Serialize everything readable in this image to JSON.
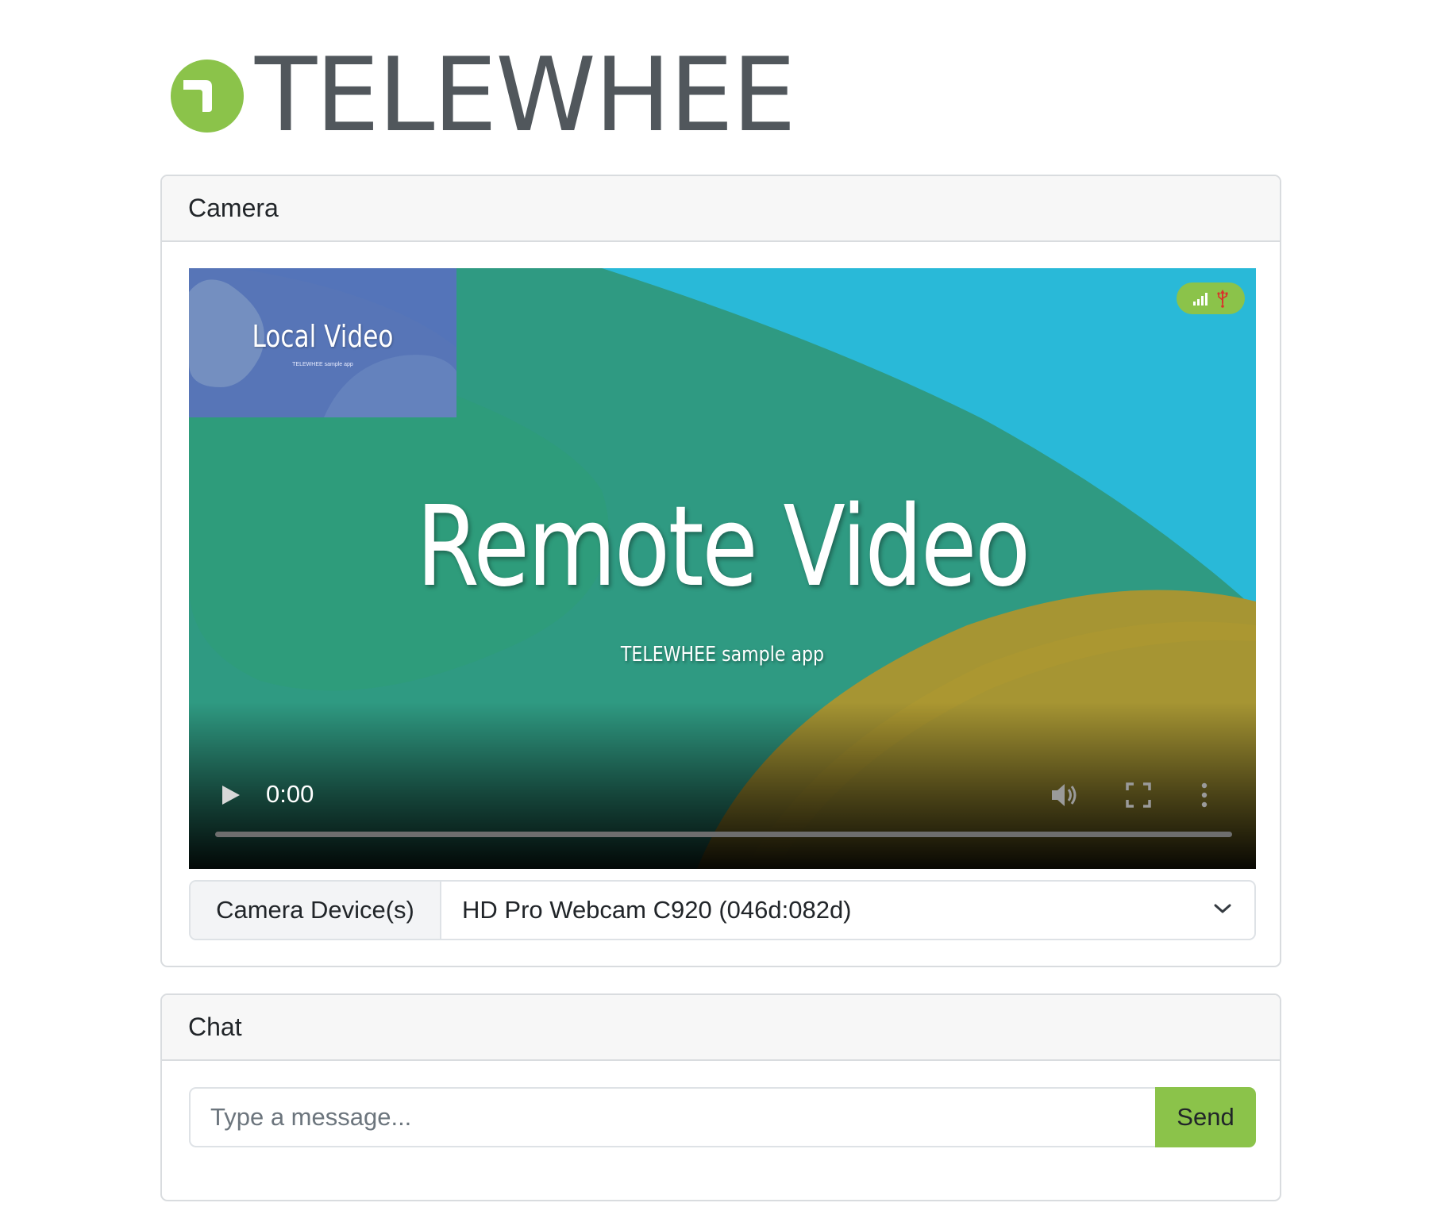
{
  "brand": {
    "name": "TELEWHEE",
    "logo": "telewhee-logo-icon",
    "logo_color": "#8bc34a",
    "text_color": "#51575c"
  },
  "camera": {
    "header": "Camera",
    "remote_video": {
      "title": "Remote Video",
      "subtitle": "TELEWHEE sample app"
    },
    "local_video": {
      "title": "Local Video",
      "subtitle": "TELEWHEE sample app"
    },
    "status_icons": [
      "signal-icon",
      "usb-icon"
    ],
    "player": {
      "time": "0:00",
      "progress": 0,
      "icons": [
        "play-icon",
        "volume-icon",
        "fullscreen-icon",
        "more-vert-icon"
      ]
    },
    "device_label": "Camera Device(s)",
    "device_selected": "HD Pro Webcam C920 (046d:082d)"
  },
  "chat": {
    "header": "Chat",
    "placeholder": "Type a message...",
    "send_label": "Send"
  },
  "colors": {
    "accent": "#8bc34a",
    "border": "#d9dcdf",
    "header_bg": "#f7f7f7"
  }
}
